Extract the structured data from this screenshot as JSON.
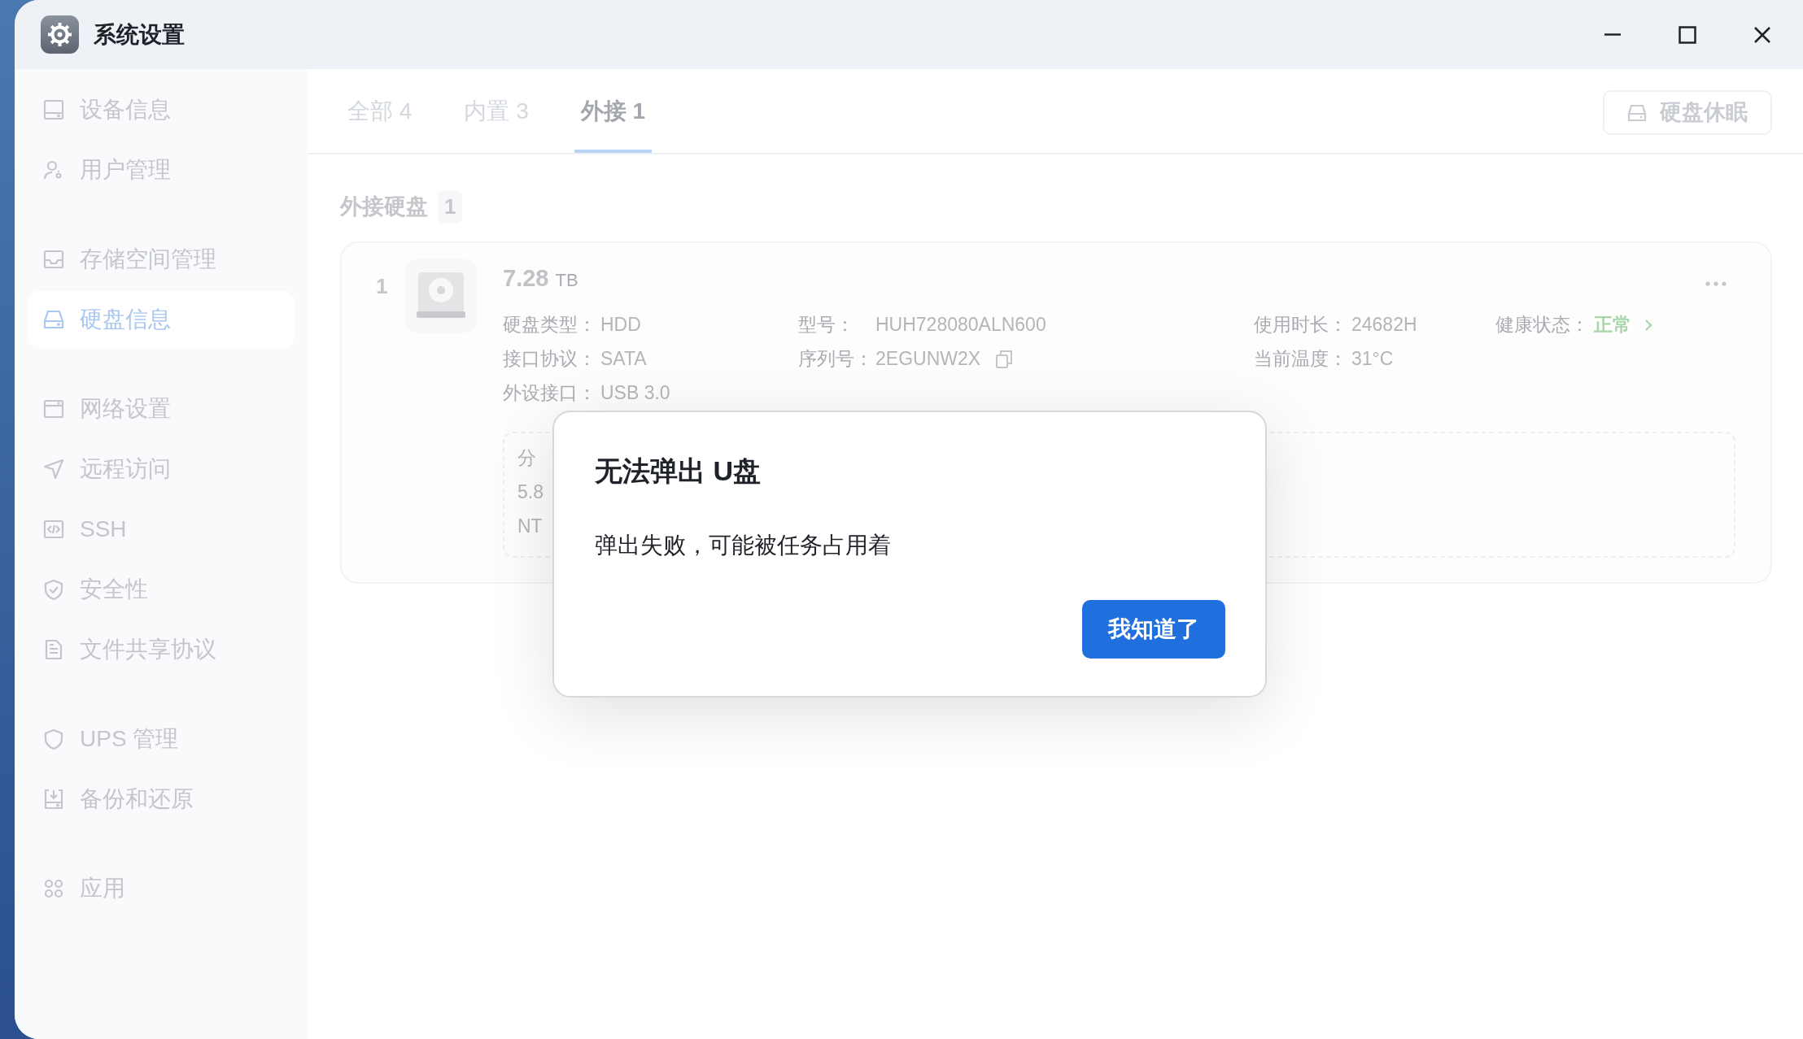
{
  "window": {
    "title": "系统设置"
  },
  "sidebar": {
    "groups": [
      {
        "items": [
          {
            "label": "设备信息",
            "selected": false
          },
          {
            "label": "用户管理",
            "selected": false
          }
        ]
      },
      {
        "items": [
          {
            "label": "存储空间管理",
            "selected": false
          },
          {
            "label": "硬盘信息",
            "selected": true
          }
        ]
      },
      {
        "items": [
          {
            "label": "网络设置",
            "selected": false
          },
          {
            "label": "远程访问",
            "selected": false
          },
          {
            "label": "SSH",
            "selected": false
          },
          {
            "label": "安全性",
            "selected": false
          },
          {
            "label": "文件共享协议",
            "selected": false
          }
        ]
      },
      {
        "items": [
          {
            "label": "UPS 管理",
            "selected": false
          },
          {
            "label": "备份和还原",
            "selected": false
          }
        ]
      },
      {
        "items": [
          {
            "label": "应用",
            "selected": false
          }
        ]
      }
    ]
  },
  "tabs": [
    {
      "label": "全部 4",
      "selected": false
    },
    {
      "label": "内置 3",
      "selected": false
    },
    {
      "label": "外接 1",
      "selected": true
    }
  ],
  "toolbar": {
    "button": "硬盘休眠"
  },
  "section": {
    "title": "外接硬盘",
    "count": "1"
  },
  "disk": {
    "index": "1",
    "size": "7.28",
    "unit": "TB",
    "columns": [
      [
        {
          "kind": "plain",
          "label": "硬盘类型：",
          "value": "HDD"
        },
        {
          "kind": "plain",
          "label": "接口协议：",
          "value": "SATA"
        },
        {
          "kind": "plain",
          "label": "外设接口：",
          "value": "USB 3.0"
        }
      ],
      [
        {
          "kind": "plain",
          "label": "型号：",
          "value": "HUH728080ALN600"
        },
        {
          "kind": "copy",
          "label": "序列号：",
          "value": "2EGUNW2X"
        }
      ],
      [
        {
          "kind": "plain",
          "label": "使用时长：",
          "value": "24682H"
        },
        {
          "kind": "plain",
          "label": "当前温度：",
          "value": "31°C"
        }
      ],
      [
        {
          "kind": "status",
          "label": "健康状态：",
          "value": "正常"
        }
      ]
    ],
    "partition": [
      "分",
      "5.8",
      "NT"
    ]
  },
  "dialog": {
    "title": "无法弹出 U盘",
    "message": "弹出失败，可能被任务占用着",
    "button": "我知道了"
  }
}
